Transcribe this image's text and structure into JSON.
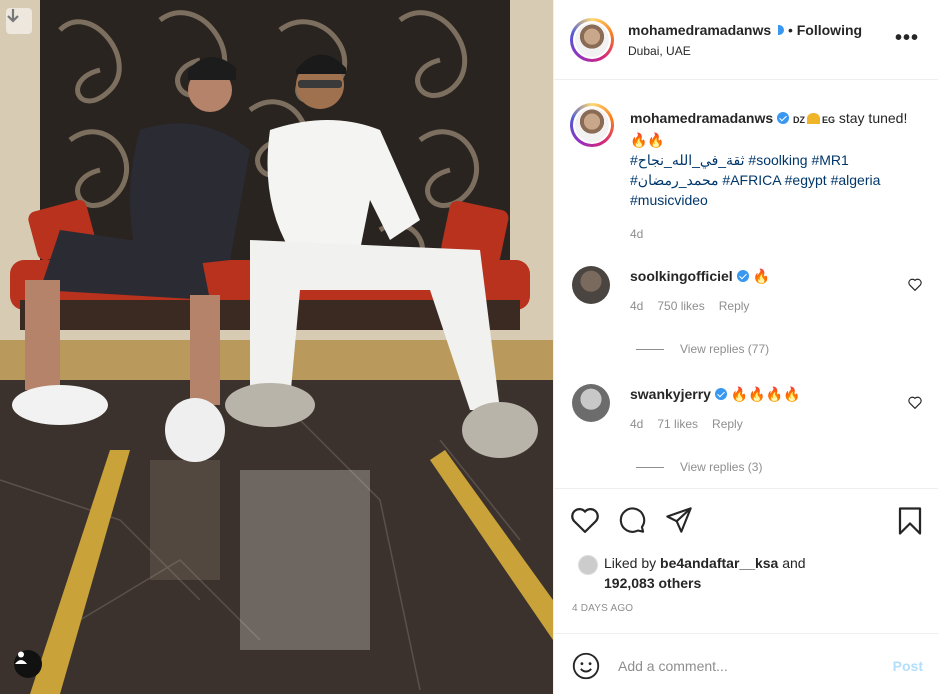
{
  "post": {
    "username": "mohamedramadanws",
    "location": "Dubai, UAE",
    "follow_separator": "•",
    "follow_status": "Following",
    "more_label": "•••"
  },
  "caption": {
    "username": "mohamedramadanws",
    "flags_text": "DZ",
    "flags_text2": "EG",
    "text": "stay tuned! 🔥🔥",
    "hashtags_line1": "#ثقة_في_الله_نجاح #soolking #MR1",
    "hashtags_line2": "#محمد_رمضان #AFRICA #egypt #algeria",
    "hashtags_line3": "#musicvideo",
    "time": "4d"
  },
  "comments": [
    {
      "username": "soolkingofficiel",
      "text": "🔥",
      "time": "4d",
      "likes": "750 likes",
      "reply": "Reply",
      "view_replies": "View replies (77)"
    },
    {
      "username": "swankyjerry",
      "text": "🔥🔥🔥🔥",
      "time": "4d",
      "likes": "71 likes",
      "reply": "Reply",
      "view_replies": "View replies (3)"
    }
  ],
  "likes": {
    "prefix": "Liked by",
    "user": "be4andaftar__ksa",
    "and": "and",
    "others": "192,083 others"
  },
  "date": "4 DAYS AGO",
  "add_comment": {
    "placeholder": "Add a comment...",
    "post_label": "Post"
  },
  "colors": {
    "link": "#00376b",
    "verified": "#3897f0",
    "muted": "#8e8e8e",
    "post_disabled": "#b2dffc",
    "fire": "#f05a24"
  }
}
